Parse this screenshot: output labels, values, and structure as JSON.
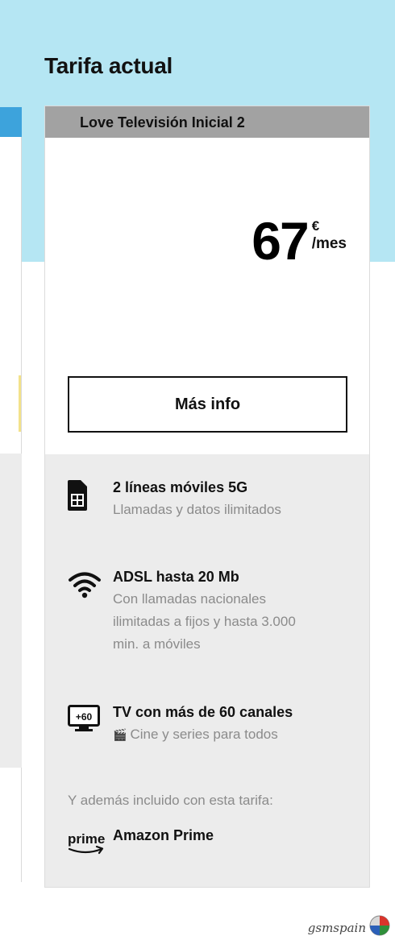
{
  "section_title": "Tarifa actual",
  "card": {
    "tariff_name": "Love Televisión Inicial 2",
    "price": {
      "amount": "67",
      "currency": "€",
      "period": "/mes"
    },
    "more_info_label": "Más info"
  },
  "features": [
    {
      "icon": "sim-card-icon",
      "title": "2 líneas móviles 5G",
      "desc": "Llamadas y datos ilimitados"
    },
    {
      "icon": "wifi-icon",
      "title": "ADSL hasta 20 Mb",
      "desc_lines": [
        "Con llamadas nacionales",
        "ilimitadas a fijos y hasta 3.000",
        "min. a móviles"
      ]
    },
    {
      "icon": "tv-icon",
      "tv_badge": "+60",
      "title": "TV con más de 60 canales",
      "desc": "Cine y series para todos"
    }
  ],
  "extras": {
    "label": "Y además incluido con esta tarifa:",
    "items": [
      {
        "icon": "amazon-prime-logo",
        "logo_text": "prime",
        "title": "Amazon Prime"
      }
    ]
  },
  "watermark": {
    "text": "gsmspain"
  }
}
